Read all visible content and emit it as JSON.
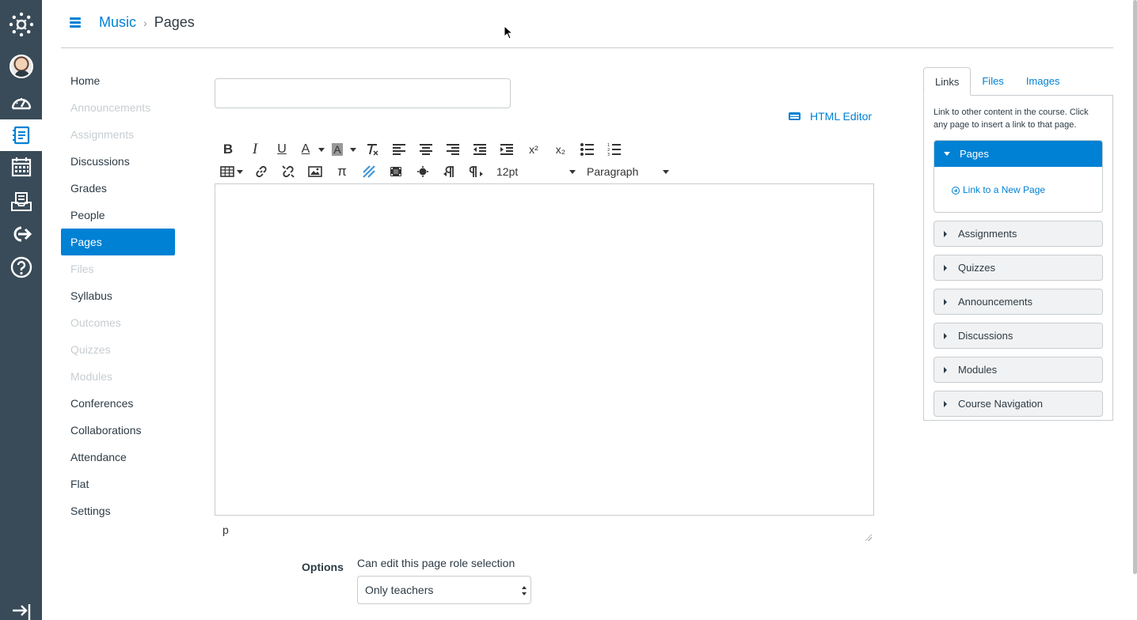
{
  "breadcrumb": {
    "course": "Music",
    "current": "Pages"
  },
  "global_nav": {
    "items": [
      {
        "icon": "canvas-logo-icon"
      },
      {
        "icon": "account-avatar-icon"
      },
      {
        "icon": "dashboard-icon"
      },
      {
        "icon": "courses-icon",
        "active": true
      },
      {
        "icon": "calendar-icon"
      },
      {
        "icon": "inbox-icon"
      },
      {
        "icon": "commons-icon"
      },
      {
        "icon": "help-icon"
      },
      {
        "icon": "collapse-nav-icon"
      }
    ]
  },
  "course_nav": {
    "items": [
      {
        "label": "Home",
        "state": "enabled"
      },
      {
        "label": "Announcements",
        "state": "disabled"
      },
      {
        "label": "Assignments",
        "state": "disabled"
      },
      {
        "label": "Discussions",
        "state": "enabled"
      },
      {
        "label": "Grades",
        "state": "enabled"
      },
      {
        "label": "People",
        "state": "enabled"
      },
      {
        "label": "Pages",
        "state": "active"
      },
      {
        "label": "Files",
        "state": "disabled"
      },
      {
        "label": "Syllabus",
        "state": "enabled"
      },
      {
        "label": "Outcomes",
        "state": "disabled"
      },
      {
        "label": "Quizzes",
        "state": "disabled"
      },
      {
        "label": "Modules",
        "state": "disabled"
      },
      {
        "label": "Conferences",
        "state": "enabled"
      },
      {
        "label": "Collaborations",
        "state": "enabled"
      },
      {
        "label": "Attendance",
        "state": "enabled"
      },
      {
        "label": "Flat",
        "state": "enabled"
      },
      {
        "label": "Settings",
        "state": "enabled"
      }
    ]
  },
  "editor": {
    "title_value": "",
    "html_editor_label": "HTML Editor",
    "toolbar": {
      "bold": "B",
      "italic": "I",
      "underline": "U",
      "text_color": "A",
      "background_color": "A",
      "superscript": "x²",
      "subscript": "x₂",
      "pi": "π",
      "font_size": "12pt",
      "block_format": "Paragraph"
    },
    "status_path": "p"
  },
  "options": {
    "label": "Options",
    "role_label": "Can edit this page role selection",
    "role_value": "Only teachers"
  },
  "sidebar": {
    "tabs": [
      {
        "label": "Links",
        "active": true
      },
      {
        "label": "Files",
        "active": false
      },
      {
        "label": "Images",
        "active": false
      }
    ],
    "description": "Link to other content in the course. Click any page to insert a link to that page.",
    "open_section": {
      "label": "Pages",
      "link": "Link to a New Page"
    },
    "sections": [
      "Assignments",
      "Quizzes",
      "Announcements",
      "Discussions",
      "Modules",
      "Course Navigation"
    ]
  },
  "colors": {
    "accent": "#0081d4",
    "global_nav_bg": "#394b58",
    "text": "#2d3b45",
    "disabled_text": "#c7cdd1",
    "border": "#c7cdd1"
  }
}
